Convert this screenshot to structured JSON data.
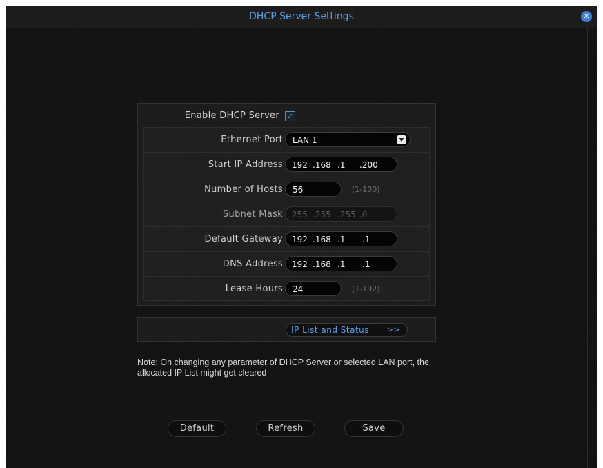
{
  "window": {
    "title": "DHCP Server Settings",
    "close_icon": "close-icon"
  },
  "enable": {
    "label": "Enable DHCP Server",
    "checked": true,
    "check_glyph": "✓"
  },
  "rows": {
    "ethernet_port": {
      "label": "Ethernet Port",
      "value": "LAN 1"
    },
    "start_ip": {
      "label": "Start IP Address",
      "o1": "192",
      "o2": ".168",
      "o3": ".1",
      "o4": ".200"
    },
    "num_hosts": {
      "label": "Number of Hosts",
      "value": "56",
      "range": "(1-100)"
    },
    "subnet_mask": {
      "label": "Subnet Mask",
      "o1": "255",
      "o2": ".255",
      "o3": ".255",
      "o4": ".0"
    },
    "default_gateway": {
      "label": "Default Gateway",
      "o1": "192",
      "o2": ".168",
      "o3": ".1",
      "o4": ".1"
    },
    "dns_address": {
      "label": "DNS Address",
      "o1": "192",
      "o2": ".168",
      "o3": ".1",
      "o4": ".1"
    },
    "lease_hours": {
      "label": "Lease Hours",
      "value": "24",
      "range": "(1-192)"
    }
  },
  "ip_list_button": {
    "label": "IP List and Status",
    "arrows": ">>"
  },
  "note": "Note: On changing any parameter of DHCP Server or selected LAN port, the allocated IP List might get cleared",
  "buttons": {
    "default": "Default",
    "refresh": "Refresh",
    "save": "Save"
  },
  "colors": {
    "accent": "#5b9fe8",
    "background": "#121212"
  }
}
